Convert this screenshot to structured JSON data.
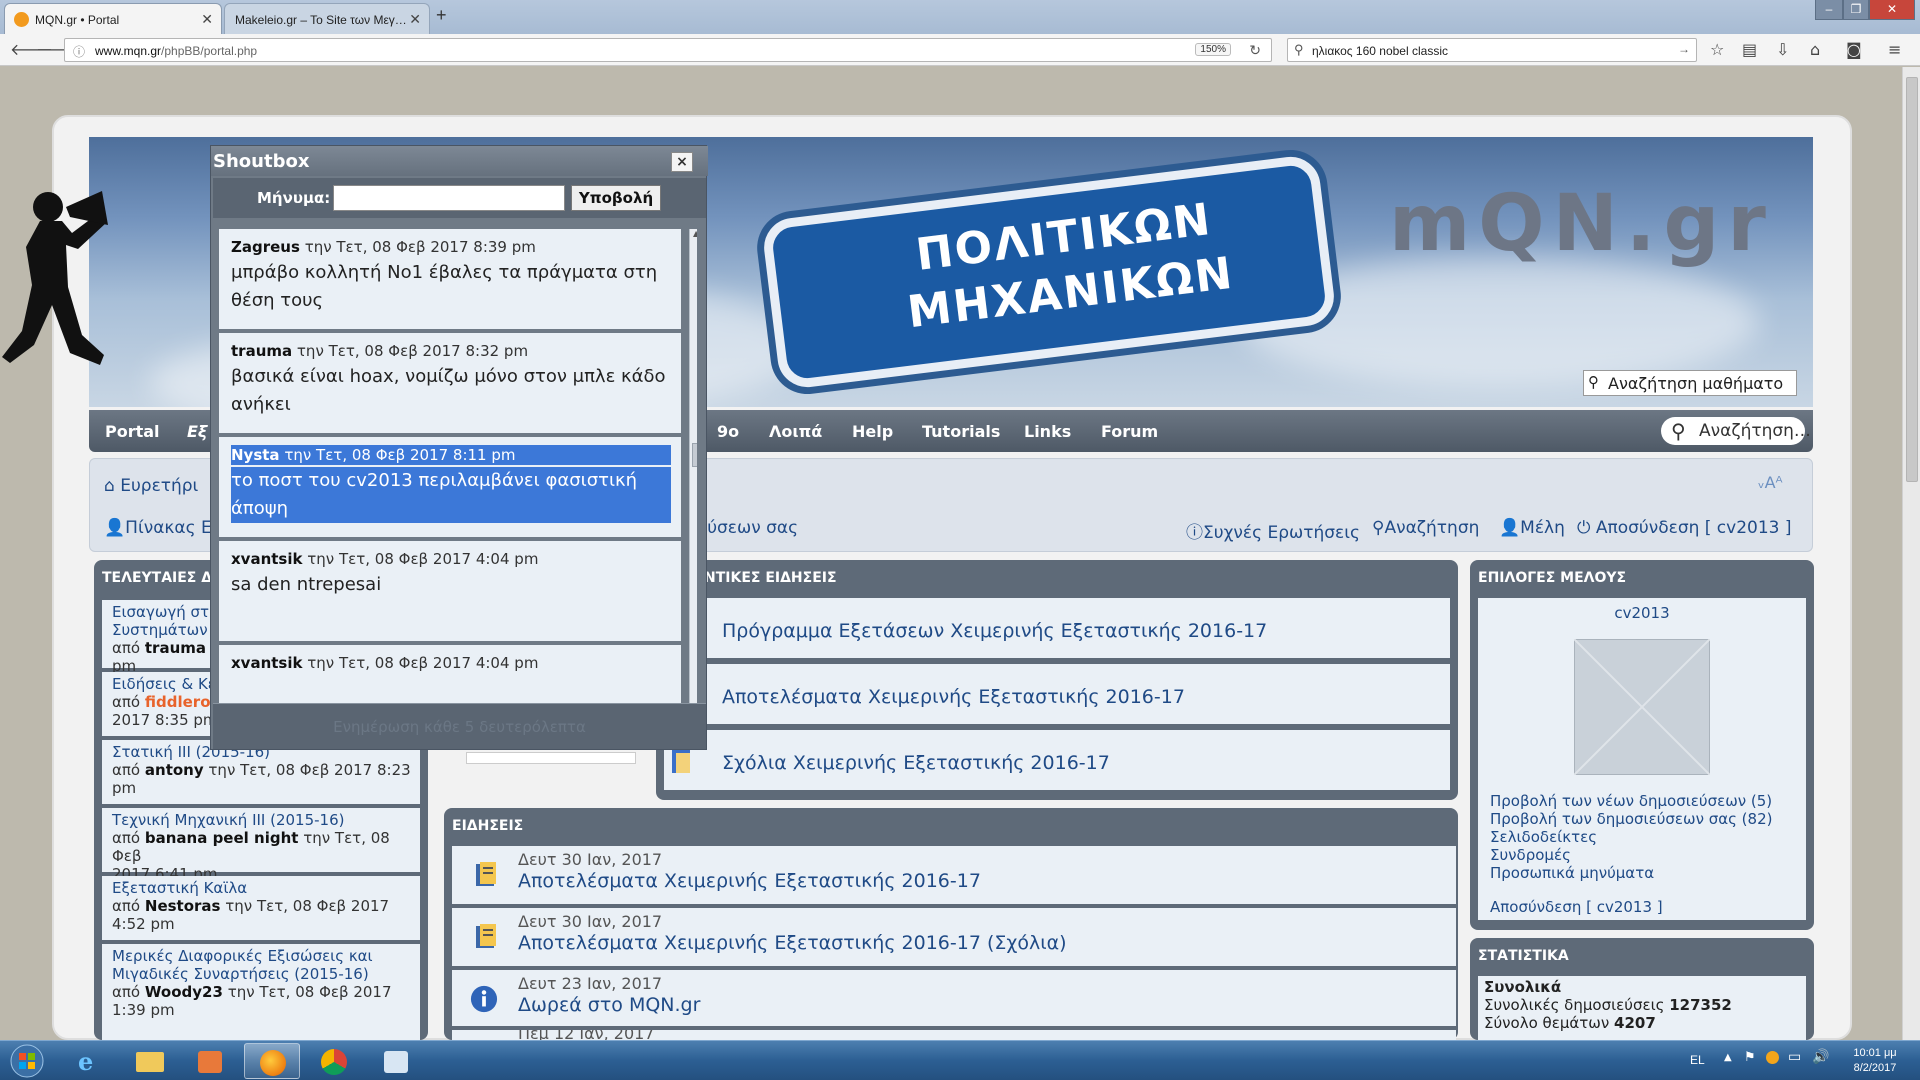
{
  "browser": {
    "tabs": [
      {
        "title": "MQN.gr • Portal",
        "active": true
      },
      {
        "title": "Makeleio.gr – To Site των Μεγ…",
        "active": false
      }
    ],
    "url_host": "www.mqn.gr",
    "url_path": "/phpBB/portal.php",
    "zoom": "150%",
    "search_query": "ηλιακος 160 nobel classic"
  },
  "banner": {
    "sign_line1": "ΠΟΛΙΤΙΚΩΝ",
    "sign_line2": "ΜΗΧΑΝΙΚΩΝ",
    "logo": "mQN.gr",
    "search_placeholder": "Αναζήτηση μαθήματο"
  },
  "menu": {
    "items": [
      "Portal",
      "Εξ",
      "9ο",
      "Λοιπά",
      "Help",
      "Tutorials",
      "Links",
      "Forum"
    ],
    "search_placeholder": "Αναζήτηση…"
  },
  "subbar": {
    "home": "Ευρετήρι",
    "board": "Πίνακας Ε",
    "your_posts_partial": "εύσεων σας",
    "faq": "Συχνές Ερωτήσεις",
    "search": "Αναζήτηση",
    "members": "Μέλη",
    "logout": "Αποσύνδεση [ cv2013 ]",
    "font_size": "ᵥAᴬ"
  },
  "left_panel": {
    "title": "ΤΕΛΕΥΤΑΙΕΣ ΔΗ",
    "items": [
      {
        "title": "Εισαγωγή στη",
        "title2": "Συστημάτων (",
        "by": "από",
        "author": "trauma",
        "meta": "",
        "tail": "pm"
      },
      {
        "title": "Ειδήσεις & Κει",
        "by": "από",
        "author": "fiddleron",
        "meta": "",
        "tail": "2017 8:35 pm"
      },
      {
        "title": "Στατική ΙΙΙ (2015-16)",
        "by": "από",
        "author": "antony",
        "meta": "την Τετ, 08 Φεβ 2017 8:23",
        "tail": "pm"
      },
      {
        "title": "Τεχνική Μηχανική ΙΙΙ (2015-16)",
        "by": "από",
        "author": "banana peel night",
        "meta": "την Τετ, 08 Φεβ",
        "tail": "2017 6:41 pm"
      },
      {
        "title": "Εξεταστική Καϊλα",
        "by": "από",
        "author": "Nestoras",
        "meta": "την Τετ, 08 Φεβ 2017",
        "tail": "4:52 pm"
      },
      {
        "title": "Μερικές Διαφορικές Εξισώσεις και",
        "title2": "Μιγαδικές Συναρτήσεις (2015-16)",
        "by": "από",
        "author": "Woody23",
        "meta": "την Τετ, 08 Φεβ 2017",
        "tail": "1:39 pm"
      }
    ]
  },
  "important_news": {
    "title": "ΝΤΙΚΕΣ ΕΙΔΗΣΕΙΣ",
    "items": [
      "Πρόγραμμα Εξετάσεων Χειμερινής Εξεταστικής 2016-17",
      "Αποτελέσματα Χειμερινής Εξεταστικής 2016-17",
      "Σχόλια Χειμερινής Εξεταστικής 2016-17"
    ]
  },
  "news": {
    "title": "ΕΙΔΗΣΕΙΣ",
    "items": [
      {
        "date": "Δευτ 30 Ιαν, 2017",
        "title": "Αποτελέσματα Χειμερινής Εξεταστικής 2016-17"
      },
      {
        "date": "Δευτ 30 Ιαν, 2017",
        "title": "Αποτελέσματα Χειμερινής Εξεταστικής 2016-17 (Σχόλια)"
      },
      {
        "date": "Δευτ 23 Ιαν, 2017",
        "title": "Δωρεά στο MQN.gr"
      }
    ],
    "partial_date": "Πέμ 12 Ιαν, 2017"
  },
  "user_panel": {
    "title": "ΕΠΙΛΟΓΕΣ ΜΕΛΟΥΣ",
    "username": "cv2013",
    "links": [
      "Προβολή των νέων δημοσιεύσεων (5)",
      "Προβολή των δημοσιεύσεων σας (82)",
      "Σελιδοδείκτες",
      "Συνδρομές",
      "Προσωπικά μηνύματα"
    ],
    "logout": "Αποσύνδεση [ cv2013 ]"
  },
  "stats_panel": {
    "title": "ΣΤΑΤΙΣΤΙΚΑ",
    "heading": "Συνολικά",
    "posts_label": "Συνολικές δημοσιεύσεις",
    "posts_value": "127352",
    "topics_label": "Σύνολο θεμάτων",
    "topics_value": "4207"
  },
  "shoutbox": {
    "title": "Shoutbox",
    "close": "×",
    "message_label": "Μήνυμα:",
    "submit": "Υποβολή",
    "footer": "Ενημέρωση κάθε 5 δευτερόλεπτα",
    "messages": [
      {
        "author": "Zagreus",
        "meta": "την Τετ, 08 Φεβ 2017 8:39 pm",
        "line1": "μπράβο κολλητή Νο1 έβαλες τα πράγματα στη",
        "line2": "θέση τους",
        "selected": false
      },
      {
        "author": "trauma",
        "meta": "την Τετ, 08 Φεβ 2017 8:32 pm",
        "line1": "βασικά είναι hoax, νομίζω μόνο στον μπλε κάδο",
        "line2": "ανήκει",
        "selected": false
      },
      {
        "author": "Nysta",
        "meta": "την Τετ, 08 Φεβ 2017 8:11 pm",
        "line1": "το ποστ του cv2013 περιλαμβάνει φασιστική",
        "line2": "άποψη",
        "selected": true
      },
      {
        "author": "xvantsik",
        "meta": "την Τετ, 08 Φεβ 2017 4:04 pm",
        "line1": "sa den ntrepesai",
        "line2": "",
        "selected": false
      },
      {
        "author": "xvantsik",
        "meta": "την Τετ, 08 Φεβ 2017 4:04 pm",
        "line1": "",
        "line2": "",
        "selected": false
      }
    ]
  },
  "taskbar": {
    "lang": "EL",
    "time": "10:01 μμ",
    "date": "8/2/2017"
  }
}
